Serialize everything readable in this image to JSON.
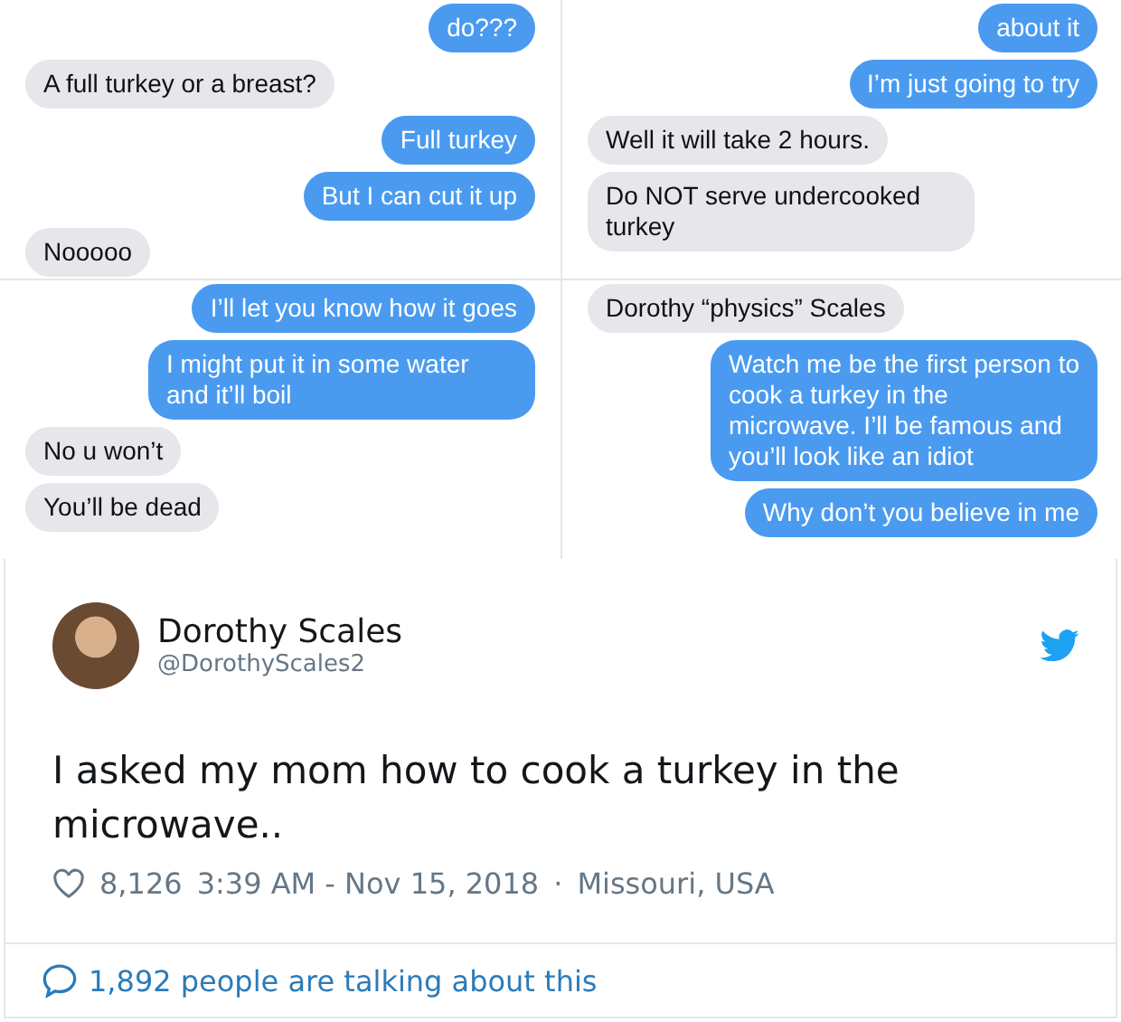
{
  "panels": [
    {
      "messages": [
        {
          "kind": "sent",
          "text": "do???"
        },
        {
          "kind": "received",
          "text": "A full turkey or a breast?"
        },
        {
          "kind": "sent",
          "text": "Full turkey"
        },
        {
          "kind": "sent",
          "text": "But I can cut it up"
        },
        {
          "kind": "received",
          "text": "Nooooo"
        }
      ]
    },
    {
      "messages": [
        {
          "kind": "sent",
          "text": "about it"
        },
        {
          "kind": "sent",
          "text": "I’m just going to try"
        },
        {
          "kind": "received",
          "text": "Well it will take 2 hours."
        },
        {
          "kind": "received",
          "text": "Do NOT serve undercooked turkey"
        }
      ]
    },
    {
      "messages": [
        {
          "kind": "sent",
          "text": "I’ll let you know how it goes"
        },
        {
          "kind": "sent",
          "text": "I might put it in some water and it’ll boil"
        },
        {
          "kind": "received",
          "text": "No u won’t"
        },
        {
          "kind": "received",
          "text": "You’ll be dead"
        }
      ]
    },
    {
      "messages": [
        {
          "kind": "received",
          "text": "Dorothy “physics” Scales"
        },
        {
          "kind": "sent",
          "text": "Watch me be the first person to cook a turkey in the microwave. I’ll be famous and you’ll look like an idiot"
        },
        {
          "kind": "sent",
          "text": "Why don’t you believe in me"
        }
      ]
    }
  ],
  "tweet": {
    "name": "Dorothy Scales",
    "handle": "@DorothyScales2",
    "text": "I asked my mom how to cook a turkey in the microwave..",
    "likes": "8,126",
    "timestamp": "3:39 AM - Nov 15, 2018",
    "separator": "·",
    "location": "Missouri, USA",
    "footer": "1,892 people are talking about this"
  }
}
